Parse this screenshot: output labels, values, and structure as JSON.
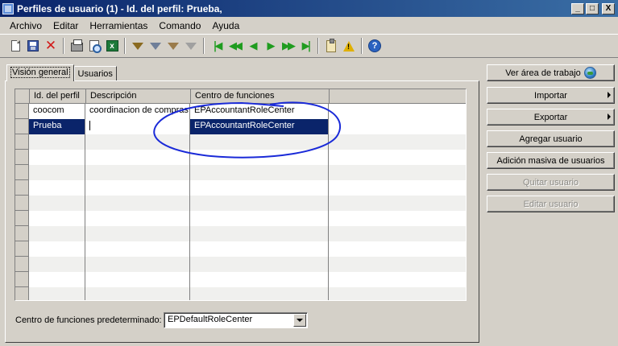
{
  "window": {
    "title": "Perfiles de usuario (1) - Id. del perfil: Prueba,",
    "controls": [
      "_",
      "□",
      "X"
    ]
  },
  "menu": [
    "Archivo",
    "Editar",
    "Herramientas",
    "Comando",
    "Ayuda"
  ],
  "toolbar": {
    "buttons": [
      "new-record",
      "save",
      "delete",
      "print",
      "print-preview",
      "export-excel",
      "filter-by-selection",
      "advanced-filter",
      "filter-by-field",
      "remove-filter",
      "first",
      "previous-page",
      "previous",
      "next",
      "next-page",
      "last",
      "document-handling",
      "alerts",
      "help"
    ]
  },
  "tabs": [
    "Visión general",
    "Usuarios"
  ],
  "grid": {
    "columns": [
      "Id. del perfil",
      "Descripción",
      "Centro de funciones"
    ],
    "rows": [
      [
        "coocom",
        "coordinacion de compras",
        "EPAccountantRoleCenter"
      ],
      [
        "Prueba",
        "",
        "EPAccountantRoleCenter"
      ]
    ],
    "selected_row": 1
  },
  "side_buttons": {
    "ver_area": "Ver área de trabajo",
    "importar": "Importar",
    "exportar": "Exportar",
    "agregar": "Agregar usuario",
    "adicion": "Adición masiva de usuarios",
    "quitar": "Quitar usuario",
    "editar": "Editar usuario"
  },
  "default_role_center": {
    "label": "Centro de funciones predeterminado:",
    "value": "EPDefaultRoleCenter"
  },
  "colors": {
    "selection": "#0a246a",
    "annotation": "#1a2ad8",
    "title_start": "#0a246a",
    "title_end": "#3a6ea5"
  }
}
